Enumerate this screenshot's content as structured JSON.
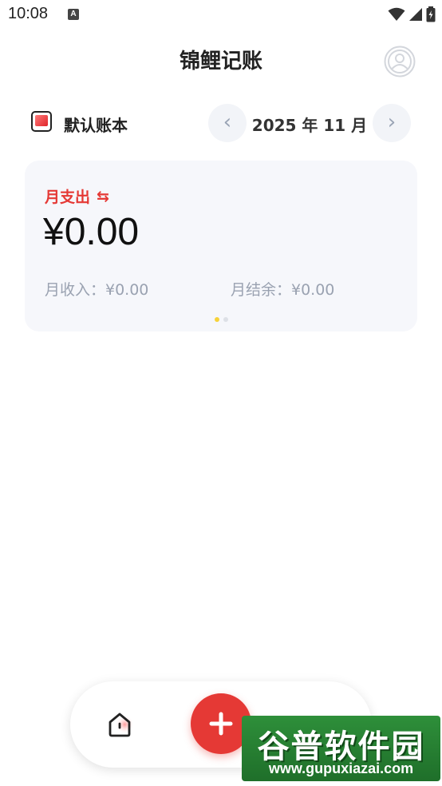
{
  "status_bar": {
    "time": "10:08",
    "notification_glyph": "A",
    "icons": [
      "wifi-icon",
      "signal-icon",
      "battery-charging-icon"
    ]
  },
  "header": {
    "title": "锦鲤记账",
    "profile_icon": "profile-icon"
  },
  "book": {
    "label": "默认账本",
    "icon": "book-icon"
  },
  "month_nav": {
    "prev_label": "‹",
    "current": "2025 年 11 月",
    "next_label": "›"
  },
  "summary": {
    "title": "月支出",
    "switch_glyph": "⇆",
    "amount": "¥0.00",
    "income": "月收入：¥0.00",
    "balance": "月结余：¥0.00",
    "pages": 2,
    "active_page": 0
  },
  "bottom_nav": {
    "home_icon": "home-icon",
    "add_icon": "plus-icon",
    "stats_icon": "stats-icon"
  },
  "watermark": {
    "top": "谷普软件园",
    "bottom": "www.gupuxiazai.com"
  },
  "colors": {
    "accent": "#e53935",
    "card_bg": "#f6f7fb",
    "muted": "#9aa2b1",
    "dot_active": "#f7d239"
  }
}
